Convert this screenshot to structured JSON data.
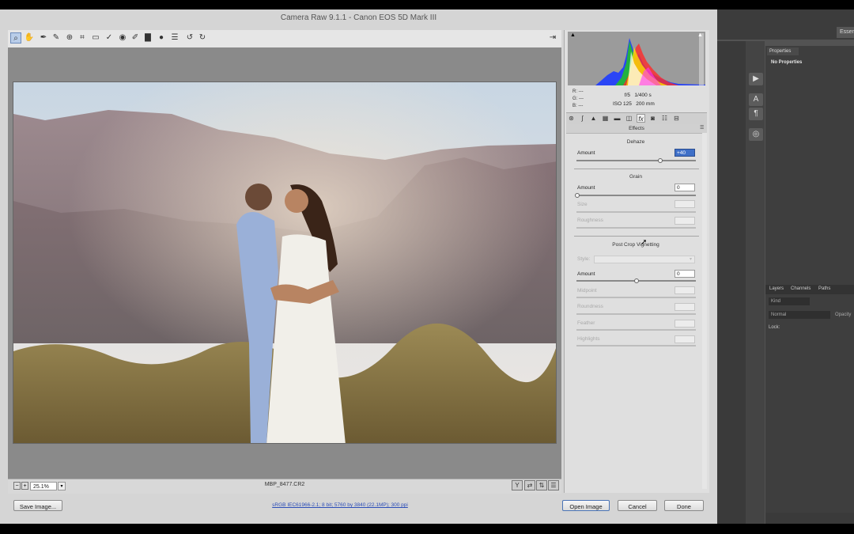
{
  "dialog": {
    "title": "Camera Raw 9.1.1  -  Canon EOS 5D Mark III",
    "filename": "MBP_8477.CR2",
    "zoom": "25.1%",
    "workflow_link": "sRGB IEC61966-2.1; 8 bit; 5760 by 3840 (22.1MP); 300 ppi",
    "buttons": {
      "save": "Save Image...",
      "open": "Open Image",
      "cancel": "Cancel",
      "done": "Done"
    }
  },
  "histogram": {
    "rgb_labels": [
      "R:",
      "G:",
      "B:"
    ],
    "rgb_values": [
      "---",
      "---",
      "---"
    ],
    "aperture": "f/5",
    "shutter": "1/400 s",
    "iso": "ISO 125",
    "focal": "200 mm"
  },
  "panel": {
    "header": "Effects",
    "dehaze": {
      "title": "Dehaze",
      "amount_label": "Amount",
      "amount_value": "+40",
      "amount_fraction": 0.7
    },
    "grain": {
      "title": "Grain",
      "amount_label": "Amount",
      "amount_value": "0",
      "size_label": "Size",
      "roughness_label": "Roughness"
    },
    "vignette": {
      "title": "Post Crop Vignetting",
      "style_label": "Style:",
      "amount_label": "Amount",
      "amount_value": "0",
      "midpoint_label": "Midpoint",
      "roundness_label": "Roundness",
      "feather_label": "Feather",
      "highlights_label": "Highlights"
    }
  },
  "photoshop": {
    "essentials": "Essen",
    "properties_tab": "Properties",
    "properties_text": "No Properties",
    "layers_tabs": [
      "Layers",
      "Channels",
      "Paths"
    ],
    "kind": "Kind",
    "blend": "Normal",
    "opacity": "Opacity",
    "lock": "Lock:"
  },
  "colors": {
    "accent": "#3f70c8",
    "link": "#2b4db8"
  }
}
